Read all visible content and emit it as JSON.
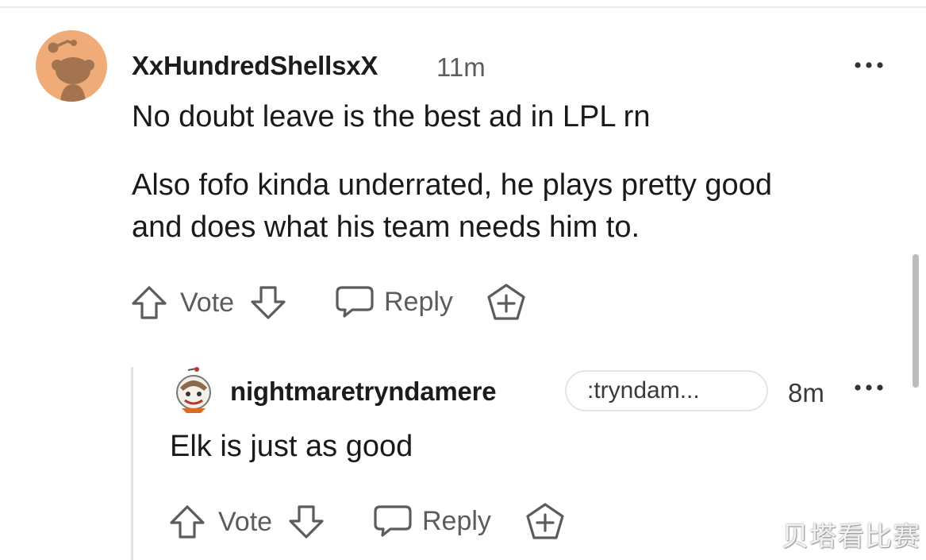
{
  "comment": {
    "username": "XxHundredShellsxX",
    "time": "11m",
    "paragraphs": [
      "No doubt leave is the best ad in LPL rn",
      "Also fofo kinda underrated, he plays pretty good",
      "and does what his team needs him to."
    ],
    "actions": {
      "vote_label": "Vote",
      "reply_label": "Reply"
    }
  },
  "reply": {
    "username": "nightmaretryndamere",
    "flair": ":tryndam...",
    "time": "8m",
    "text": "Elk is just as good",
    "actions": {
      "vote_label": "Vote",
      "reply_label": "Reply"
    }
  },
  "watermark": "贝塔看比赛",
  "icons": {
    "upvote": "upvote-arrow-icon",
    "downvote": "downvote-arrow-icon",
    "reply": "speech-bubble-icon",
    "award": "award-plus-icon",
    "more": "more-dots-icon"
  },
  "colors": {
    "avatar_bg": "#f0ac78",
    "meta_text": "#5c5c5c",
    "thread_line": "#e3e3e3"
  }
}
